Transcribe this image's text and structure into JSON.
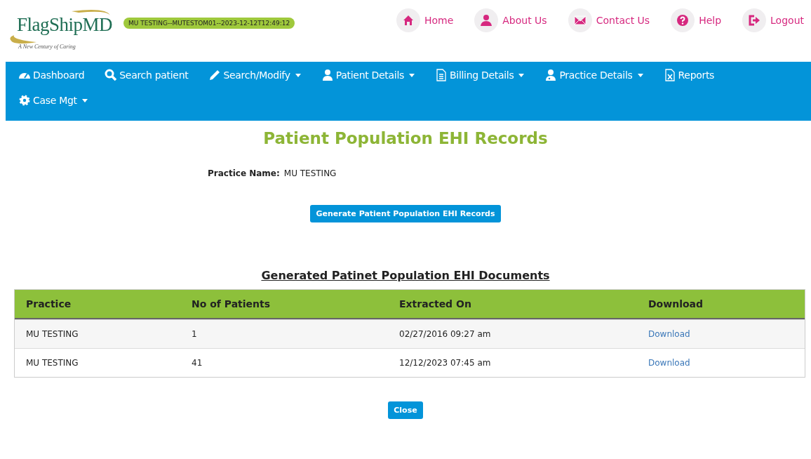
{
  "logo": {
    "name": "FlagShipMD",
    "tagline": "A New Century of Caring"
  },
  "session_badge": "MU TESTING--MUTESTOM01--2023-12-12T12:49:12",
  "top_links": [
    {
      "label": "Home"
    },
    {
      "label": "About Us"
    },
    {
      "label": "Contact Us"
    },
    {
      "label": "Help"
    },
    {
      "label": "Logout"
    }
  ],
  "nav": [
    {
      "label": "Dashboard",
      "has_menu": false
    },
    {
      "label": "Search patient",
      "has_menu": false
    },
    {
      "label": "Search/Modify",
      "has_menu": true
    },
    {
      "label": "Patient Details",
      "has_menu": true
    },
    {
      "label": "Billing Details",
      "has_menu": true
    },
    {
      "label": "Practice Details",
      "has_menu": true
    },
    {
      "label": "Reports",
      "has_menu": false
    },
    {
      "label": "Case Mgt",
      "has_menu": true
    }
  ],
  "page_title": "Patient Population EHI Records",
  "practice": {
    "label": "Practice Name:",
    "value": "MU TESTING"
  },
  "generate_button": "Generate Patient Population EHI Records",
  "table": {
    "title": "Generated Patinet Population EHI Documents",
    "columns": [
      "Practice",
      "No of Patients",
      "Extracted On",
      "Download"
    ],
    "rows": [
      {
        "practice": "MU TESTING",
        "patients": "1",
        "extracted": "02/27/2016 09:27 am",
        "link": "Download"
      },
      {
        "practice": "MU TESTING",
        "patients": "41",
        "extracted": "12/12/2023 07:45 am",
        "link": "Download"
      }
    ]
  },
  "close_button": "Close"
}
